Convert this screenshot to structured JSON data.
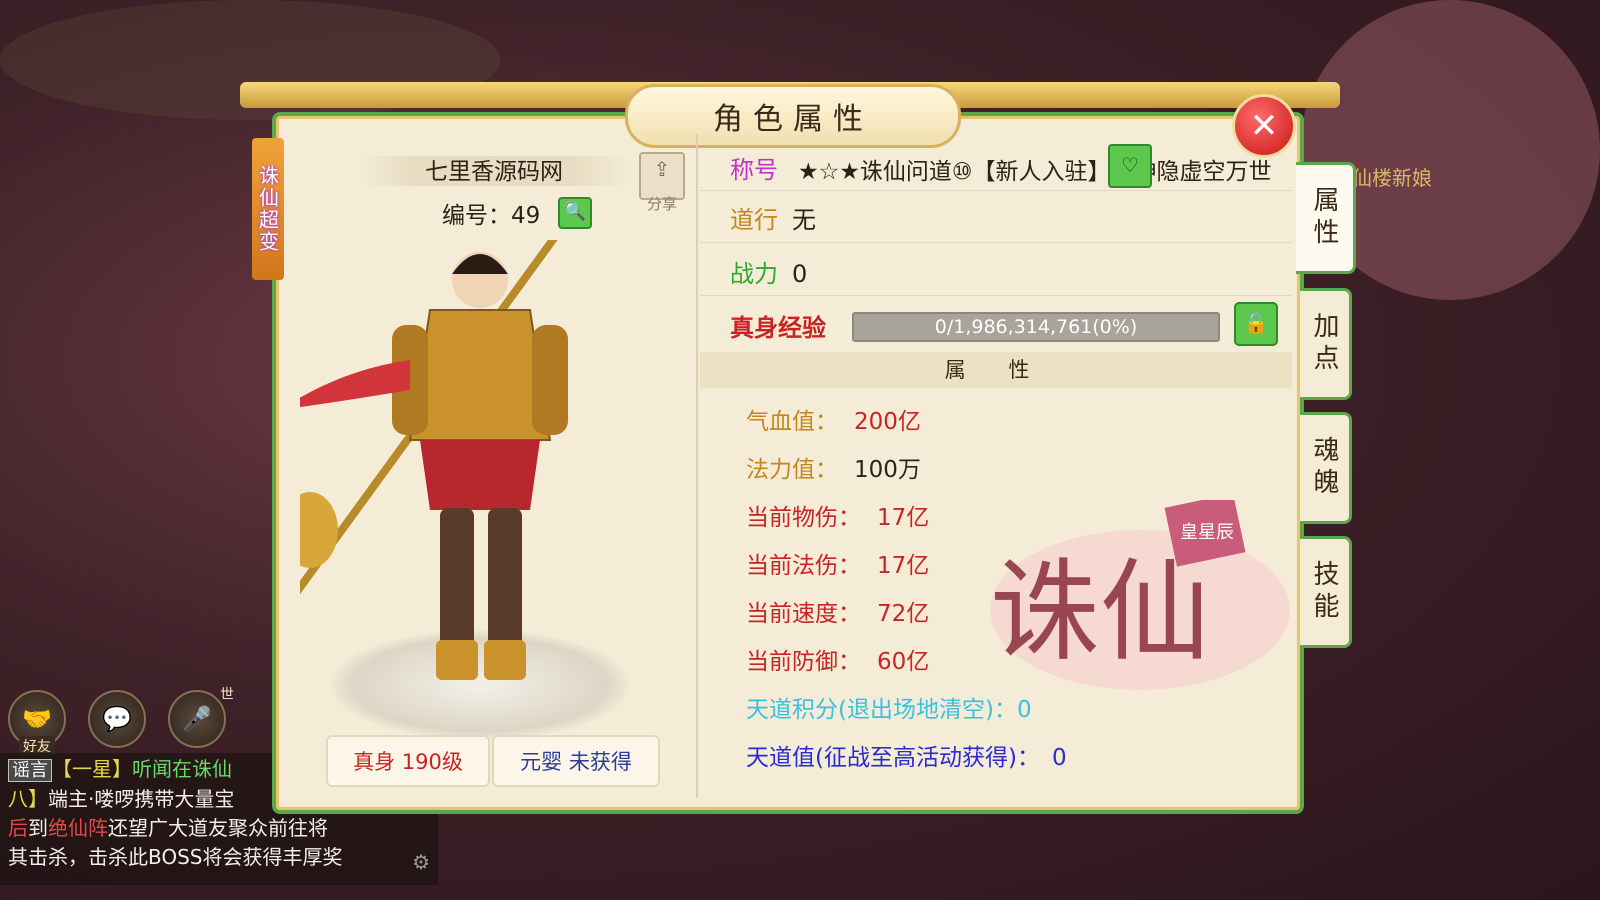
{
  "window": {
    "title": "角色属性"
  },
  "ribbon": {
    "label": "诛仙超变"
  },
  "character": {
    "name": "七里香源码网",
    "id_label": "编号：49",
    "share_label": "分享",
    "level_button": "真身 190级",
    "yuanying_button": "元婴 未获得"
  },
  "info": {
    "title_label": "称号",
    "title_value": "★☆★诛仙问道⑩【新人入驻】シ神隐虚空万世",
    "dao_label": "道行",
    "dao_value": "无",
    "power_label": "战力",
    "power_value": "0",
    "exp_label": "真身经验",
    "exp_value": "0/1,986,314,761(0%)",
    "exp_progress_percent": 0
  },
  "attributes": {
    "header": "属 性",
    "items": [
      {
        "label": "气血值：",
        "value": "200亿"
      },
      {
        "label": "法力值：",
        "value": "100万"
      },
      {
        "label": "当前物伤：",
        "value": "17亿"
      },
      {
        "label": "当前法伤：",
        "value": "17亿"
      },
      {
        "label": "当前速度：",
        "value": "72亿"
      },
      {
        "label": "当前防御：",
        "value": "60亿"
      }
    ],
    "tiandao_points_label": "天道积分(退出场地清空)：",
    "tiandao_points_value": "0",
    "tiandao_value_label": "天道值(征战至高活动获得)：",
    "tiandao_value_value": "0"
  },
  "tabs": [
    {
      "label": "属性",
      "active": true
    },
    {
      "label": "加点",
      "active": false
    },
    {
      "label": "魂魄",
      "active": false
    },
    {
      "label": "技能",
      "active": false
    }
  ],
  "chat": {
    "friend_label": "好友",
    "voice_superscript": "世",
    "message_tag": "谣言",
    "message_line1_a": "【一星】",
    "message_line1_b": "听闻在诛仙",
    "message_line2_a": "八】",
    "message_line2_b": "端主·喽啰携带大量宝",
    "message_line3_a": "后",
    "message_line3_b": "到",
    "message_line3_c": "绝仙阵",
    "message_line3_d": "还望广大道友聚众前往将",
    "message_line4": "其击杀，击杀此BOSS将会获得丰厚奖"
  },
  "logo": {
    "text": "诛仙",
    "seal": "皇星辰"
  },
  "background": {
    "npc_label": "仙楼新娘"
  },
  "colors": {
    "panel_border": "#5aa84a",
    "gold": "#e7c46a",
    "red_text": "#c82424"
  }
}
